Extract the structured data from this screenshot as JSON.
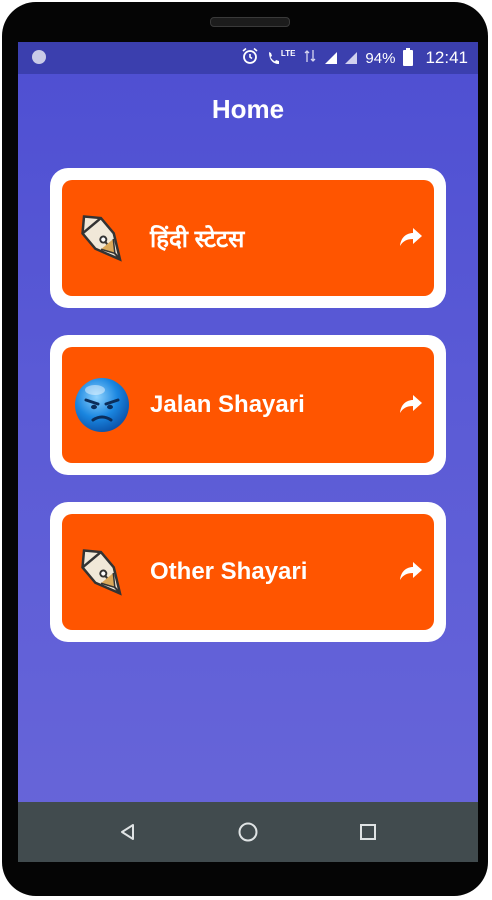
{
  "status_bar": {
    "battery": "94%",
    "time": "12:41",
    "network": "LTE"
  },
  "app_bar": {
    "title": "Home"
  },
  "menu": [
    {
      "label": "हिंदी स्टेटस",
      "icon": "fountain-pen-icon"
    },
    {
      "label": "Jalan Shayari",
      "icon": "angry-face-icon"
    },
    {
      "label": "Other Shayari",
      "icon": "fountain-pen-icon"
    }
  ],
  "colors": {
    "background_top": "#4e4fd2",
    "background_bottom": "#6866d9",
    "card_fill": "#ff5500",
    "card_border": "#ffffff",
    "status_bar": "#3b3fae",
    "nav_bar": "#414b4e"
  },
  "nav_bar": {
    "back_icon": "back-triangle-icon",
    "home_icon": "home-circle-icon",
    "recents_icon": "recents-square-icon"
  }
}
